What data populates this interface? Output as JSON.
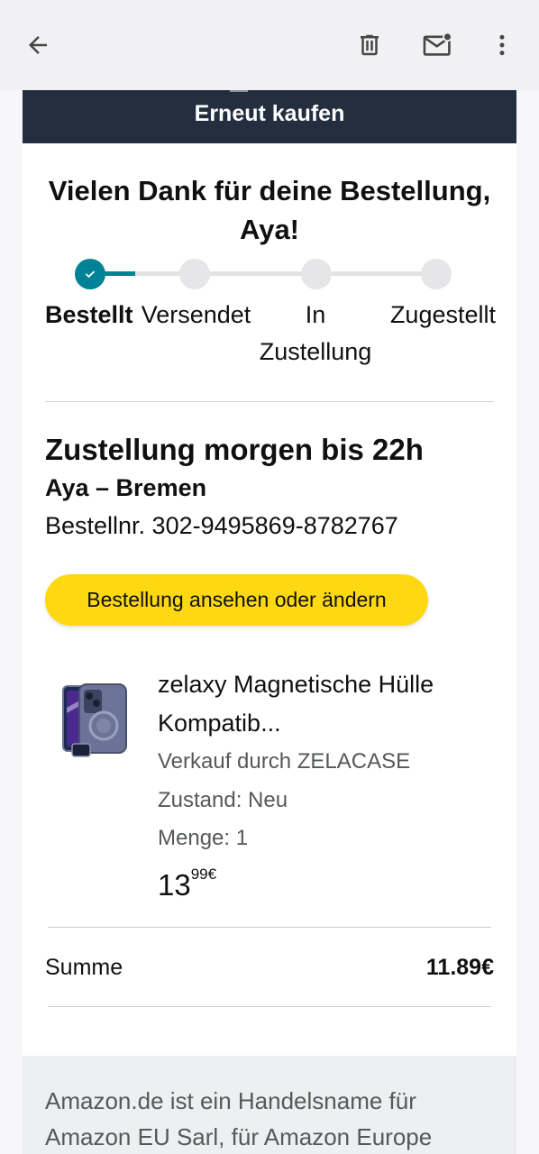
{
  "toolbar": {
    "back_icon": "arrow-left-icon",
    "delete_icon": "trash-icon",
    "mark_unread_icon": "mail-unread-icon",
    "more_icon": "more-vert-icon"
  },
  "email": {
    "banner_label": "Erneut kaufen",
    "heading": "Vielen Dank für deine Bestellung, Aya!",
    "progress": {
      "current_step": 1,
      "steps": [
        {
          "label": "Bestellt",
          "state": "done"
        },
        {
          "label": "Versendet",
          "state": "pending"
        },
        {
          "label": "In Zustellung",
          "state": "pending"
        },
        {
          "label": "Zugestellt",
          "state": "pending"
        }
      ]
    },
    "delivery_title": "Zustellung morgen bis 22h",
    "recipient": "Aya – Bremen",
    "order_number": "Bestellnr. 302-9495869-8782767",
    "order_button_label": "Bestellung ansehen oder ändern",
    "product": {
      "name": "zelaxy Magnetische Hülle Kompatib...",
      "seller": "Verkauf durch ZELACASE",
      "condition": "Zustand: Neu",
      "quantity": "Menge: 1",
      "price_whole": "13",
      "price_fraction": "99€"
    },
    "total_label": "Summe",
    "total_value": "11.89€",
    "footer_text": "Amazon.de ist ein Handelsname für Amazon EU Sarl, für Amazon Europe"
  },
  "colors": {
    "banner": "#232f3e",
    "accent_teal": "#008296",
    "button_yellow": "#ffd814",
    "toolbar": "#f1f1f4"
  }
}
